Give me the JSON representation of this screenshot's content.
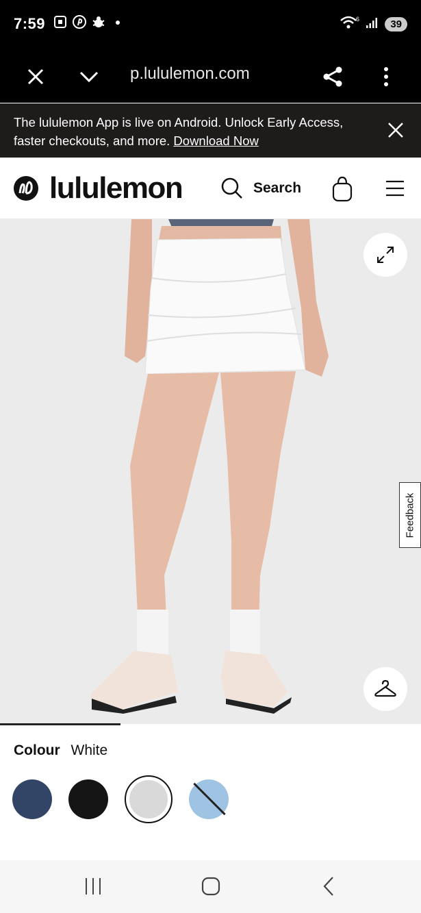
{
  "status_bar": {
    "time": "7:59",
    "network": "6",
    "battery": "39"
  },
  "browser": {
    "url": "p.lululemon.com"
  },
  "banner": {
    "text": "The lululemon App is live on Android. Unlock Early Access, faster checkouts, and more.",
    "link": "Download Now"
  },
  "header": {
    "brand": "lululemon",
    "search_label": "Search"
  },
  "product": {
    "feedback_label": "Feedback",
    "colour_label": "Colour",
    "colour_value": "White",
    "swatches": [
      {
        "name": "navy",
        "color": "#334566",
        "selected": false,
        "unavailable": false
      },
      {
        "name": "black",
        "color": "#151515",
        "selected": false,
        "unavailable": false
      },
      {
        "name": "white",
        "color": "#d9d9d9",
        "selected": true,
        "unavailable": false
      },
      {
        "name": "light-blue",
        "color": "#9fc3e3",
        "selected": false,
        "unavailable": true
      }
    ]
  },
  "colors": {
    "banner_bg": "#1e1b1b",
    "browser_bg": "#000000",
    "image_bg": "#ececec"
  }
}
